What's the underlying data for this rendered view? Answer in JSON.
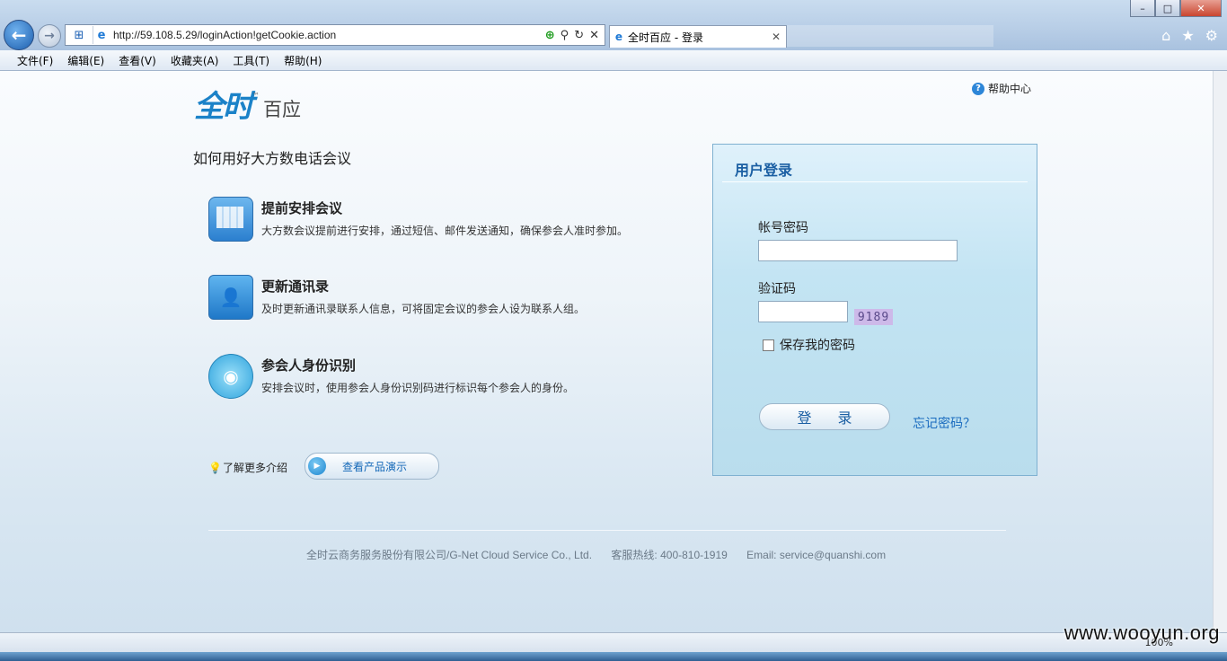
{
  "browser": {
    "url": "http://59.108.5.29/loginAction!getCookie.action",
    "tab_title": "全时百应 - 登录",
    "menu": [
      "文件(F)",
      "编辑(E)",
      "查看(V)",
      "收藏夹(A)",
      "工具(T)",
      "帮助(H)"
    ],
    "zoom": "100%",
    "icons": {
      "back": "back-arrow-icon",
      "forward": "forward-arrow-icon",
      "home": "home-icon",
      "favorites": "star-icon",
      "tools": "gear-icon"
    }
  },
  "page": {
    "help_label": "帮助中心",
    "logo_text": "百应",
    "logo_mark": "全时",
    "intro_title": "如何用好大方数电话会议",
    "features": [
      {
        "title": "提前安排会议",
        "desc": "大方数会议提前进行安排，通过短信、邮件发送通知，确保参会人准时参加。"
      },
      {
        "title": "更新通讯录",
        "desc": "及时更新通讯录联系人信息，可将固定会议的参会人设为联系人组。"
      },
      {
        "title": "参会人身份识别",
        "desc": "安排会议时，使用参会人身份识别码进行标识每个参会人的身份。"
      }
    ],
    "more_label": "了解更多介绍",
    "demo_label": "查看产品演示"
  },
  "login": {
    "title": "用户登录",
    "account_label": "帐号密码",
    "account_value": "",
    "captcha_label": "验证码",
    "captcha_value": "",
    "captcha_image_text": "9189",
    "remember_label": "保存我的密码",
    "submit_label": "登 录",
    "forgot_label": "忘记密码？"
  },
  "footer": {
    "company": "全时云商务服务股份有限公司/G-Net Cloud Service Co., Ltd.",
    "hotline": "客服热线: 400-810-1919",
    "email": "Email: service@quanshi.com"
  },
  "watermark": "www.wooyun.org",
  "colors": {
    "accent": "#1b5fa3",
    "logo_blue": "#1b82c8",
    "logo_green": "#66b32e"
  }
}
